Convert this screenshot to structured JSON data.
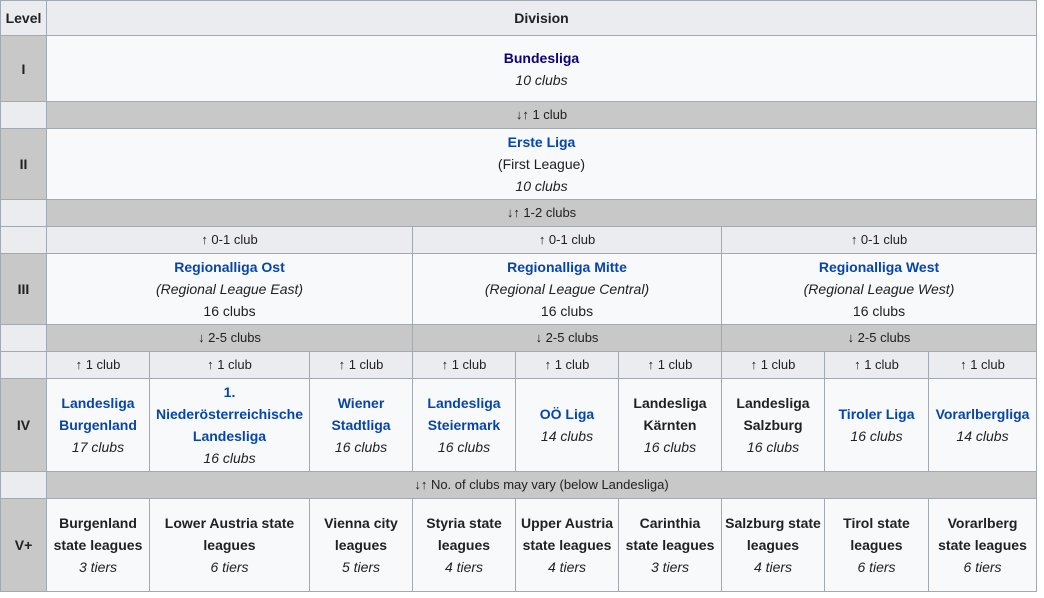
{
  "header": {
    "level": "Level",
    "division": "Division"
  },
  "levels": {
    "l1": "I",
    "l2": "II",
    "l3": "III",
    "l4": "IV",
    "l5": "V+"
  },
  "bundesliga": {
    "name": "Bundesliga",
    "clubs": "10 clubs"
  },
  "movement_1_2": "↓↑ 1 club",
  "erste_liga": {
    "name": "Erste Liga",
    "sub": "(First League)",
    "clubs": "10 clubs"
  },
  "movement_2_3": "↓↑ 1-2 clubs",
  "regional_up": [
    "↑ 0-1 club",
    "↑ 0-1 club",
    "↑ 0-1 club"
  ],
  "regional": [
    {
      "name": "Regionalliga Ost",
      "sub": "(Regional League East)",
      "clubs": "16 clubs"
    },
    {
      "name": "Regionalliga Mitte",
      "sub": "(Regional League Central)",
      "clubs": "16 clubs"
    },
    {
      "name": "Regionalliga West",
      "sub": "(Regional League West)",
      "clubs": "16 clubs"
    }
  ],
  "regional_down": [
    "↓ 2-5 clubs",
    "↓ 2-5 clubs",
    "↓ 2-5 clubs"
  ],
  "landes_up": [
    "↑ 1 club",
    "↑ 1 club",
    "↑ 1 club",
    "↑ 1 club",
    "↑ 1 club",
    "↑ 1 club",
    "↑ 1 club",
    "↑ 1 club",
    "↑ 1 club"
  ],
  "landes": [
    {
      "name": "Landesliga Burgenland",
      "clubs": "17 clubs"
    },
    {
      "name": "1. Niederösterreichische Landesliga",
      "clubs": "16 clubs"
    },
    {
      "name": "Wiener Stadtliga",
      "clubs": "16 clubs"
    },
    {
      "name": "Landesliga Steiermark",
      "clubs": "16 clubs"
    },
    {
      "name": "OÖ Liga",
      "clubs": "14 clubs"
    },
    {
      "name": "Landesliga Kärnten",
      "clubs": "16 clubs"
    },
    {
      "name": "Landesliga Salzburg",
      "clubs": "16 clubs"
    },
    {
      "name": "Tiroler Liga",
      "clubs": "16 clubs"
    },
    {
      "name": "Vorarlbergliga",
      "clubs": "14 clubs"
    }
  ],
  "movement_4_5": "↓↑ No. of clubs may vary (below Landesliga)",
  "state": [
    {
      "name": "Burgenland state leagues",
      "tiers": "3 tiers"
    },
    {
      "name": "Lower Austria state leagues",
      "tiers": "6 tiers"
    },
    {
      "name": "Vienna city leagues",
      "tiers": "5 tiers"
    },
    {
      "name": "Styria state leagues",
      "tiers": "4 tiers"
    },
    {
      "name": "Upper Austria state leagues",
      "tiers": "4 tiers"
    },
    {
      "name": "Carinthia state leagues",
      "tiers": "3 tiers"
    },
    {
      "name": "Salzburg state leagues",
      "tiers": "4 tiers"
    },
    {
      "name": "Tirol state leagues",
      "tiers": "6 tiers"
    },
    {
      "name": "Vorarlberg state leagues",
      "tiers": "6 tiers"
    }
  ],
  "colors": {
    "link": "#0645ad",
    "visited_link": "#0b0080",
    "movement_bg": "#c8c8c8",
    "header_bg": "#eaecf0",
    "cell_bg": "#f8f9fa",
    "border": "#a2a9b1"
  }
}
